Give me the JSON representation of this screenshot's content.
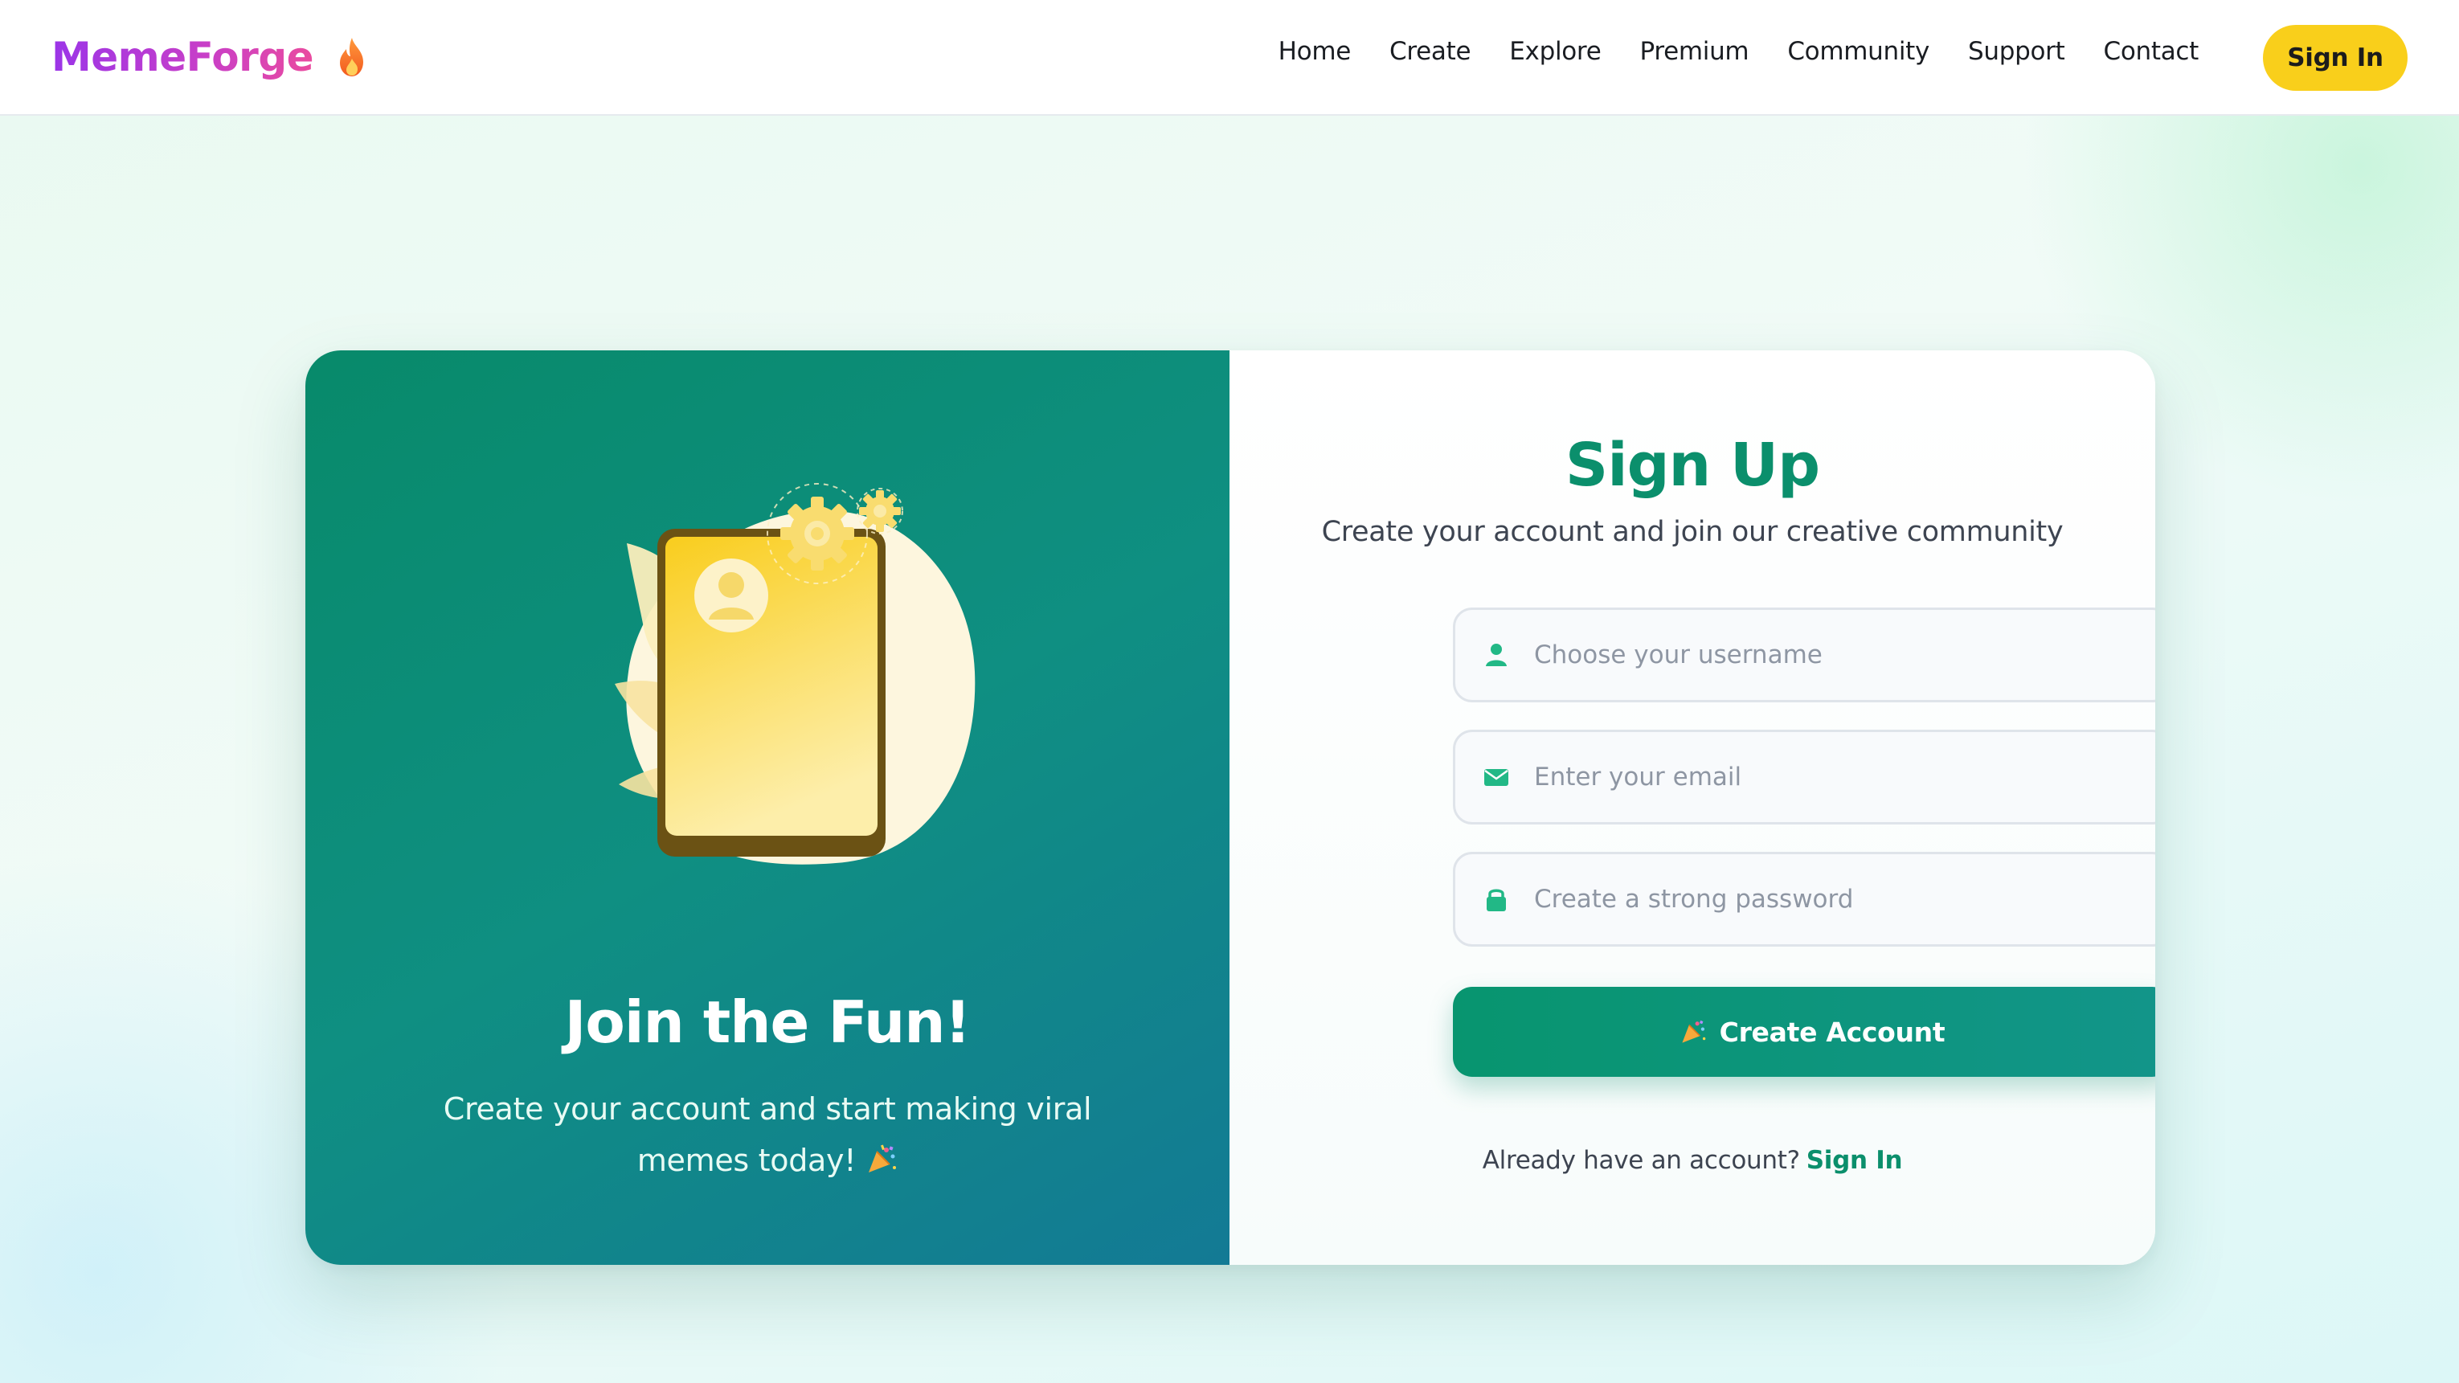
{
  "nav": {
    "brand": "MemeForge",
    "links": [
      "Home",
      "Create",
      "Explore",
      "Premium",
      "Community",
      "Support",
      "Contact"
    ],
    "signin_label": "Sign In"
  },
  "hero": {
    "title": "Join the Fun!",
    "subtitle": "Create your account and start making viral memes today!"
  },
  "form": {
    "title": "Sign Up",
    "subtitle": "Create your account and join our creative community",
    "username_placeholder": "Choose your username",
    "email_placeholder": "Enter your email",
    "password_placeholder": "Create a strong password",
    "submit_label": "Create Account",
    "already_text": "Already have an account?",
    "signin_link": "Sign In"
  },
  "colors": {
    "brand_gradient_start": "#9b35e8",
    "brand_gradient_end": "#ea4b9f",
    "accent_green": "#0b8f6c",
    "signin_yellow": "#f9cf1b",
    "panel_teal": "#0f8f82"
  },
  "icons": {
    "brand": "fire-icon",
    "username": "user-icon",
    "email": "envelope-icon",
    "password": "lock-icon",
    "submit": "party-popper-icon"
  }
}
